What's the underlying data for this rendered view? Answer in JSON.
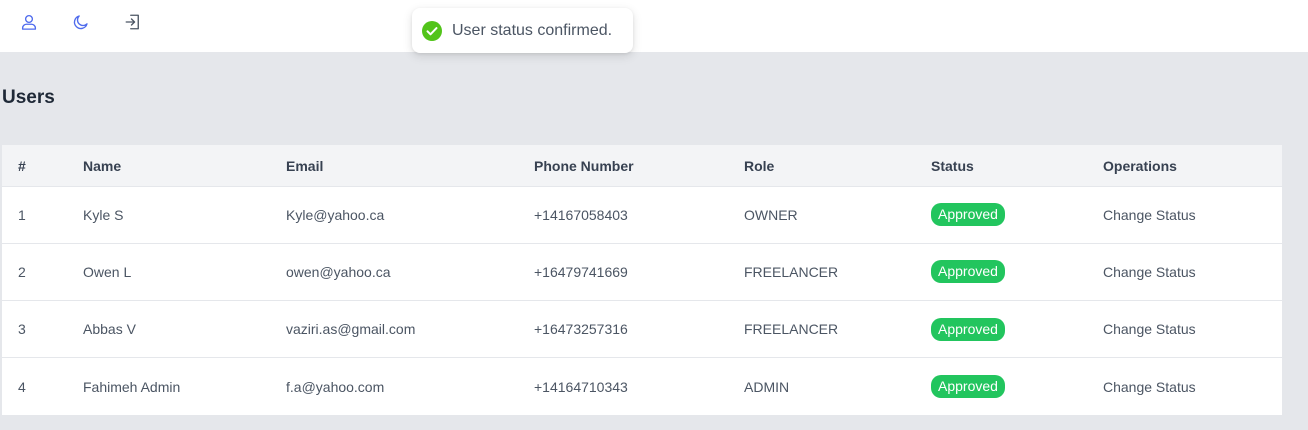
{
  "header": {
    "icons": [
      "user-icon",
      "moon-icon",
      "logout-icon"
    ]
  },
  "toast": {
    "message": "User status confirmed."
  },
  "page": {
    "title": "Users"
  },
  "table": {
    "columns": [
      "#",
      "Name",
      "Email",
      "Phone Number",
      "Role",
      "Status",
      "Operations"
    ],
    "rows": [
      {
        "index": "1",
        "name": "Kyle S",
        "email": "Kyle@yahoo.ca",
        "phone": "+14167058403",
        "role": "OWNER",
        "status": "Approved",
        "operation": "Change Status"
      },
      {
        "index": "2",
        "name": "Owen L",
        "email": "owen@yahoo.ca",
        "phone": "+16479741669",
        "role": "FREELANCER",
        "status": "Approved",
        "operation": "Change Status"
      },
      {
        "index": "3",
        "name": "Abbas V",
        "email": "vaziri.as@gmail.com",
        "phone": "+16473257316",
        "role": "FREELANCER",
        "status": "Approved",
        "operation": "Change Status"
      },
      {
        "index": "4",
        "name": "Fahimeh Admin",
        "email": "f.a@yahoo.com",
        "phone": "+14164710343",
        "role": "ADMIN",
        "status": "Approved",
        "operation": "Change Status"
      }
    ]
  },
  "colors": {
    "accent": "#4f6bed",
    "approved": "#22c55e",
    "toast_success": "#52c41a"
  }
}
